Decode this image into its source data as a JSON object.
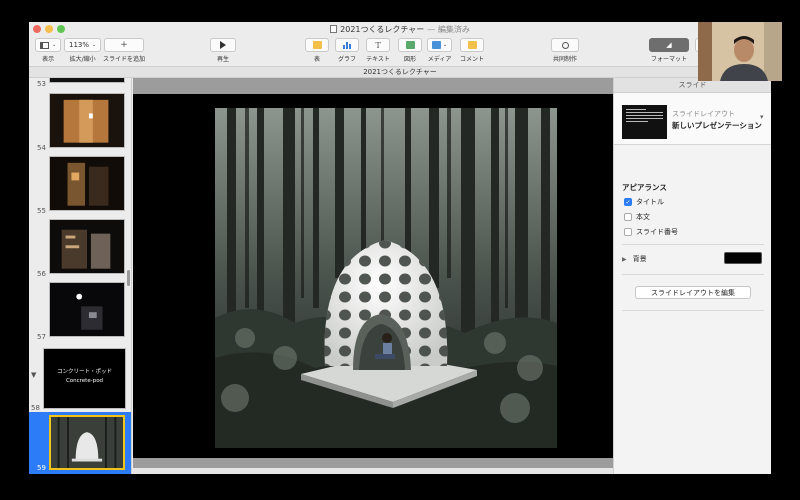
{
  "window": {
    "title": "2021つくるレクチャー",
    "status": "— 編集済み"
  },
  "toolbar": {
    "view_label": "表示",
    "zoom_value": "113%",
    "zoom_label": "拡大/縮小",
    "add_slide_label": "スライドを追加",
    "play_label": "再生",
    "table_label": "表",
    "chart_label": "グラフ",
    "text_label": "テキスト",
    "shape_label": "図形",
    "media_label": "メディア",
    "comment_label": "コメント",
    "collab_label": "共同制作",
    "format_label": "フォーマット",
    "animate_label_partial": "ア"
  },
  "document_bar": {
    "title": "2021つくるレクチャー"
  },
  "navigator": {
    "slides": [
      {
        "number": "53"
      },
      {
        "number": "54"
      },
      {
        "number": "55"
      },
      {
        "number": "56"
      },
      {
        "number": "57"
      },
      {
        "number": "58",
        "title_jp": "コンクリート・ポッド",
        "title_en": "Concrete-pod"
      },
      {
        "number": "59",
        "selected": true
      }
    ]
  },
  "inspector": {
    "tab_label": "スライド",
    "layout_sub": "スライドレイアウト",
    "layout_name": "新しいプレゼンテーション",
    "appearance_header": "アピアランス",
    "options": [
      {
        "label": "タイトル",
        "checked": true
      },
      {
        "label": "本文",
        "checked": false
      },
      {
        "label": "スライド番号",
        "checked": false
      }
    ],
    "background_label": "背景",
    "background_color": "#000000",
    "edit_layout_label": "スライドレイアウトを編集"
  },
  "colors": {
    "accent": "#2b7cf6",
    "selection_border": "#f0c419"
  }
}
